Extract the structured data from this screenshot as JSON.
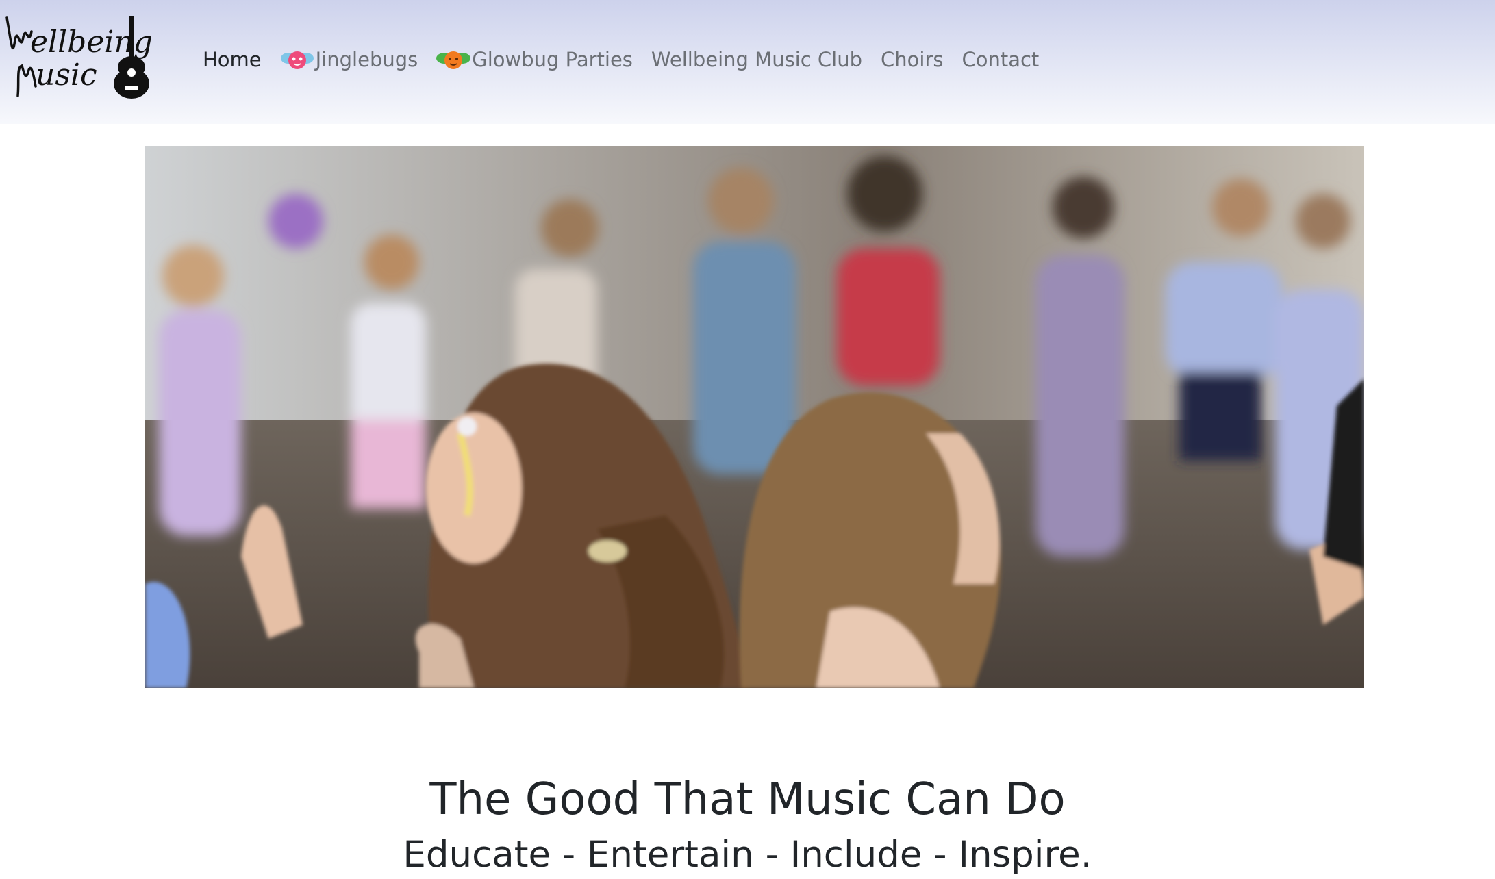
{
  "brand": {
    "logo_text_line1": "Wellbeing",
    "logo_text_line2": "Music",
    "logo_icon": "guitar-icon"
  },
  "nav": {
    "items": [
      {
        "label": "Home",
        "active": true
      },
      {
        "label": "Jinglebugs",
        "icon": "pink-bug-icon"
      },
      {
        "label": "Glowbug Parties",
        "icon": "orange-bug-icon"
      },
      {
        "label": "Wellbeing Music Club"
      },
      {
        "label": "Choirs"
      },
      {
        "label": "Contact"
      }
    ]
  },
  "hero": {
    "image": "children dancing at a party"
  },
  "content": {
    "headline": "The Good That Music Can Do",
    "tagline": "Educate - Entertain - Include - Inspire."
  },
  "colors": {
    "nav_gradient_top": "#cdd2ec",
    "nav_gradient_bottom": "#f7f8fc",
    "text_dark": "#212529",
    "nav_text": "#6b6f75"
  }
}
